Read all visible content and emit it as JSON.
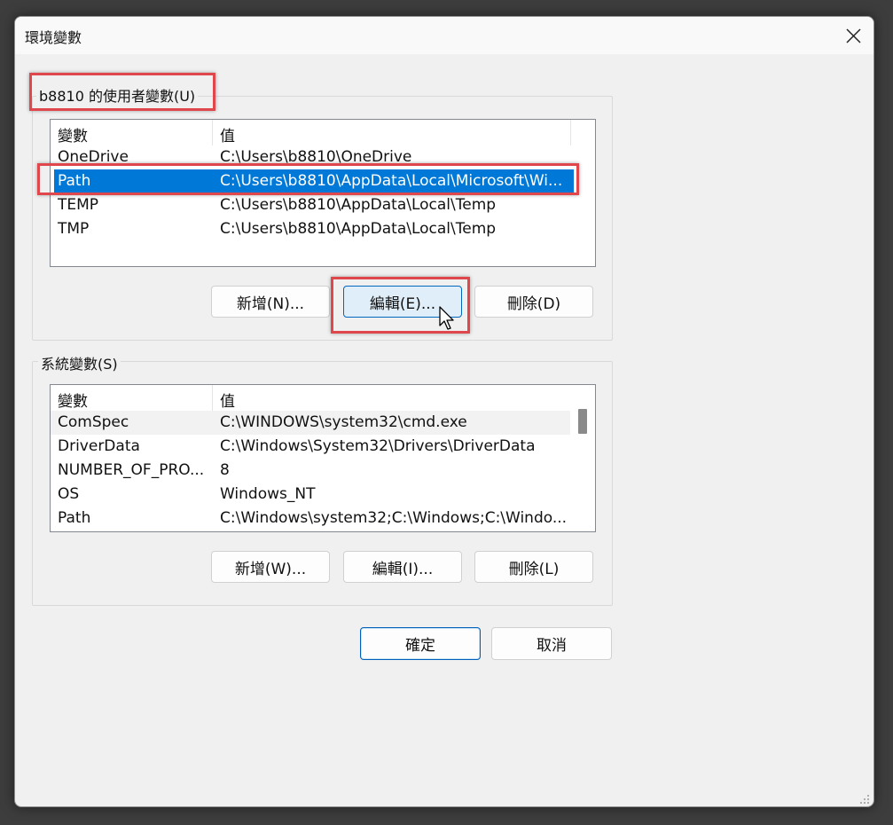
{
  "window": {
    "title": "環境變數"
  },
  "user_vars": {
    "group_label": "b8810 的使用者變數(U)",
    "columns": [
      "變數",
      "值"
    ],
    "rows": [
      {
        "name": "OneDrive",
        "value": "C:\\Users\\b8810\\OneDrive"
      },
      {
        "name": "Path",
        "value": "C:\\Users\\b8810\\AppData\\Local\\Microsoft\\Wi...",
        "selected": true
      },
      {
        "name": "TEMP",
        "value": "C:\\Users\\b8810\\AppData\\Local\\Temp"
      },
      {
        "name": "TMP",
        "value": "C:\\Users\\b8810\\AppData\\Local\\Temp"
      }
    ],
    "new_label": "新增(N)...",
    "edit_label": "編輯(E)...",
    "delete_label": "刪除(D)"
  },
  "system_vars": {
    "group_label": "系統變數(S)",
    "columns": [
      "變數",
      "值"
    ],
    "rows": [
      {
        "name": "ComSpec",
        "value": "C:\\WINDOWS\\system32\\cmd.exe"
      },
      {
        "name": "DriverData",
        "value": "C:\\Windows\\System32\\Drivers\\DriverData"
      },
      {
        "name": "NUMBER_OF_PRO...",
        "value": "8"
      },
      {
        "name": "OS",
        "value": "Windows_NT"
      },
      {
        "name": "Path",
        "value": "C:\\Windows\\system32;C:\\Windows;C:\\Windo..."
      }
    ],
    "new_label": "新增(W)...",
    "edit_label": "編輯(I)...",
    "delete_label": "刪除(L)"
  },
  "footer": {
    "ok_label": "確定",
    "cancel_label": "取消"
  },
  "colors": {
    "selection": "#0078d7",
    "annotation": "#e0474c",
    "default_button_border": "#005fb8"
  },
  "icons": [
    "close-icon",
    "mouse-cursor-icon",
    "resize-grip-icon"
  ]
}
